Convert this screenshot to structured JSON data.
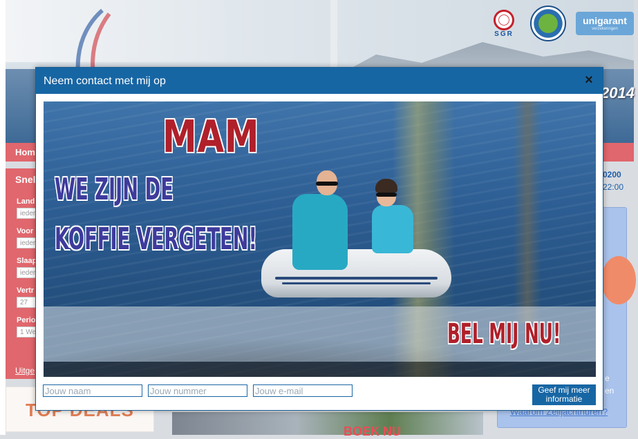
{
  "background": {
    "hero_year": "2014",
    "nav_home": "Home",
    "sidebar_title": "Snel",
    "sidebar_fields": [
      {
        "label": "Land",
        "value": "ieder"
      },
      {
        "label": "Voor",
        "value": "ieder"
      },
      {
        "label": "Slaap",
        "value": "ieder"
      },
      {
        "label": "Vertr",
        "value": "27"
      },
      {
        "label": "Perio",
        "value": "1 We"
      }
    ],
    "sidebar_link": "Uitge",
    "topdeals": "TOP DEALS",
    "boek_nu": "BOEK NU",
    "phone": "0200",
    "hours": "22:00",
    "right_text_1": "e",
    "right_text_2": "en",
    "right_link": "Waarom Zeiljachthuren?",
    "logos": {
      "sgr": "SGR",
      "garantie": "PRIJS/KWALITEIT GARANTIE",
      "unigarant": "unigarant",
      "unigarant_sub": "verzekeringen"
    }
  },
  "modal": {
    "title": "Neem contact met mij op",
    "close": "×",
    "promo": {
      "headline": "MAM",
      "line1": "WE ZIJN DE",
      "line2": "KOFFIE VERGETEN!",
      "cta": "BEL MIJ NU!"
    },
    "form": {
      "name_placeholder": "Jouw naam",
      "phone_placeholder": "Jouw nummer",
      "email_placeholder": "Jouw e-mail",
      "submit": "Geef mij meer informatie"
    }
  },
  "colors": {
    "modal_header": "#1766a4",
    "nav_red": "#e0676d",
    "headline_red": "#b0202a",
    "headline_blue": "#3e3b9c"
  }
}
